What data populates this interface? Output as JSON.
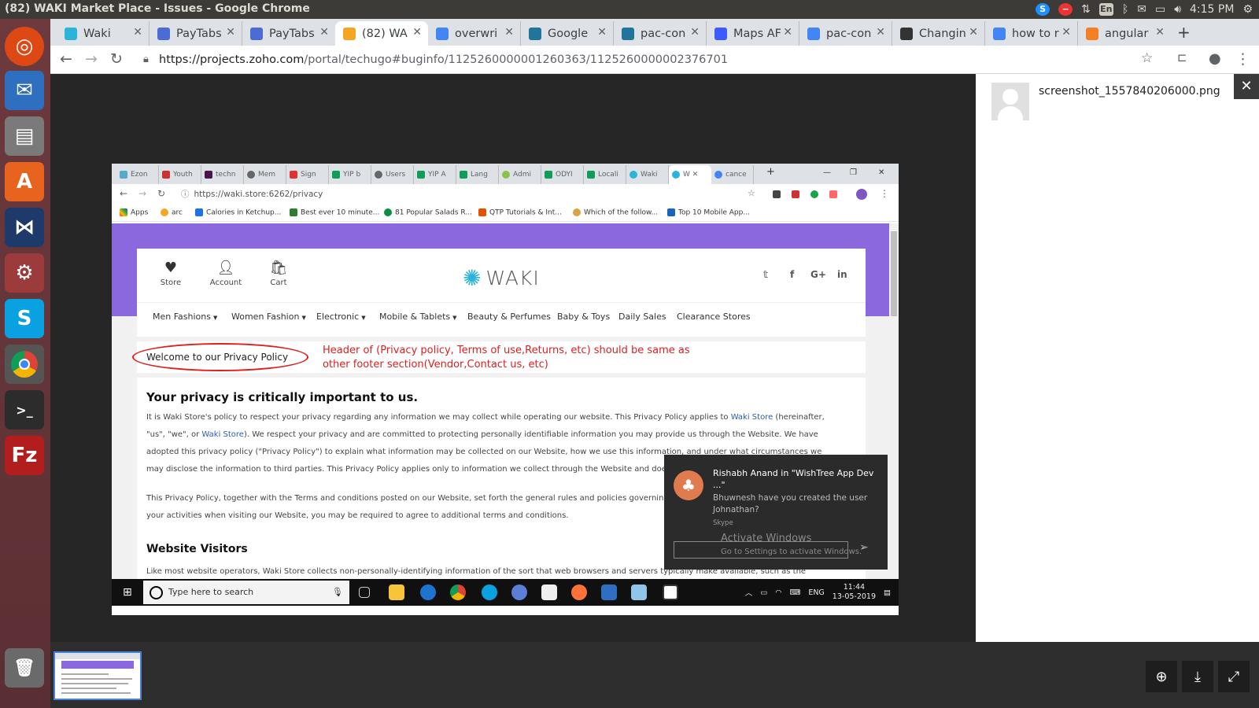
{
  "window": {
    "title": "(82) WAKI Market Place - Issues - Google Chrome",
    "time": "4:15 PM",
    "lang": "En"
  },
  "tabs": [
    {
      "label": "Waki",
      "color": "#2bb3d9",
      "active": false
    },
    {
      "label": "PayTabs",
      "color": "#4a6cd4",
      "active": false
    },
    {
      "label": "PayTabs",
      "color": "#4a6cd4",
      "active": false
    },
    {
      "label": "(82) WA",
      "color": "#f4a623",
      "active": true
    },
    {
      "label": "overwri",
      "color": "#4285f4",
      "active": false
    },
    {
      "label": "Google",
      "color": "#21759b",
      "active": false
    },
    {
      "label": "pac-con",
      "color": "#21759b",
      "active": false
    },
    {
      "label": "Maps AF",
      "color": "#3d5afe",
      "active": false
    },
    {
      "label": "pac-con",
      "color": "#4285f4",
      "active": false
    },
    {
      "label": "Changin",
      "color": "#333333",
      "active": false
    },
    {
      "label": "how to r",
      "color": "#4285f4",
      "active": false
    },
    {
      "label": "angular",
      "color": "#f48024",
      "active": false
    }
  ],
  "address": {
    "host": "https://projects.zoho.com",
    "path": "/portal/techugo#buginfo/1125260000001260363/1125260000002376701"
  },
  "attachment": {
    "filename": "screenshot_1557840206000.png"
  },
  "shot": {
    "tabs": [
      "Ezon",
      "Youth",
      "techn",
      "Mem",
      "Sign",
      "YIP b",
      "Users",
      "YIP A",
      "Lang",
      "Admi",
      "ODYI",
      "Locali",
      "Waki",
      "W",
      "cance"
    ],
    "url": "https://waki.store:6262/privacy",
    "bookmarks": [
      "Apps",
      "arc",
      "Calories in Ketchup...",
      "Best ever 10 minute...",
      "81 Popular Salads R...",
      "QTP Tutorials & Int...",
      "Which of the follow...",
      "Top 10 Mobile App..."
    ],
    "header": {
      "store": "Store",
      "account": "Account",
      "cart": "Cart",
      "logo": "WAKI"
    },
    "menu": [
      "Men Fashions",
      "Women Fashion",
      "Electronic",
      "Mobile & Tablets",
      "Beauty & Perfumes",
      "Baby & Toys",
      "Daily Sales",
      "Clearance Stores"
    ],
    "crumb": "Welcome to our Privacy Policy",
    "annotation": "Header of (Privacy policy, Terms of use,Returns, etc) should be same as other footer section(Vendor,Contact us, etc)",
    "heading1": "Your privacy is critically important to us.",
    "para1_a": "It is Waki Store's policy to respect your privacy regarding any information we may collect while operating our website. This Privacy Policy applies to ",
    "para1_link1": "Waki Store",
    "para1_b": " (hereinafter, \"us\", \"we\", or ",
    "para1_link2": "Waki Store",
    "para1_c": "). We respect your privacy and are committed to protecting personally identifiable information you may provide us through the Website. We have adopted this privacy policy (\"Privacy Policy\") to explain what information may be collected on our Website, how we use this information, and under what circumstances we may disclose the information to third parties. This Privacy Policy applies only to information we collect through the Website and does not apply to our collection of information",
    "para2": "This Privacy Policy, together with the Terms and conditions posted on our Website, set forth the general rules and policies governing your use of our Website. Depending on your activities when visiting our Website, you may be required to agree to additional terms and conditions.",
    "heading2": "Website Visitors",
    "para3": "Like most website operators, Waki Store collects non-personally-identifying information of the sort that web browsers and servers typically make available, such as the browser type,",
    "toast": {
      "name": "Rishabh Anand in \"WishTree App Dev ...\"",
      "message": "Bhuwnesh have you created the user Johnathan?",
      "source": "Skype"
    },
    "activate_title": "Activate Windows",
    "activate_sub": "Go to Settings to activate Windows.",
    "taskbar": {
      "search": "Type here to search",
      "lang": "ENG",
      "time": "11:44",
      "date": "13-05-2019"
    }
  }
}
